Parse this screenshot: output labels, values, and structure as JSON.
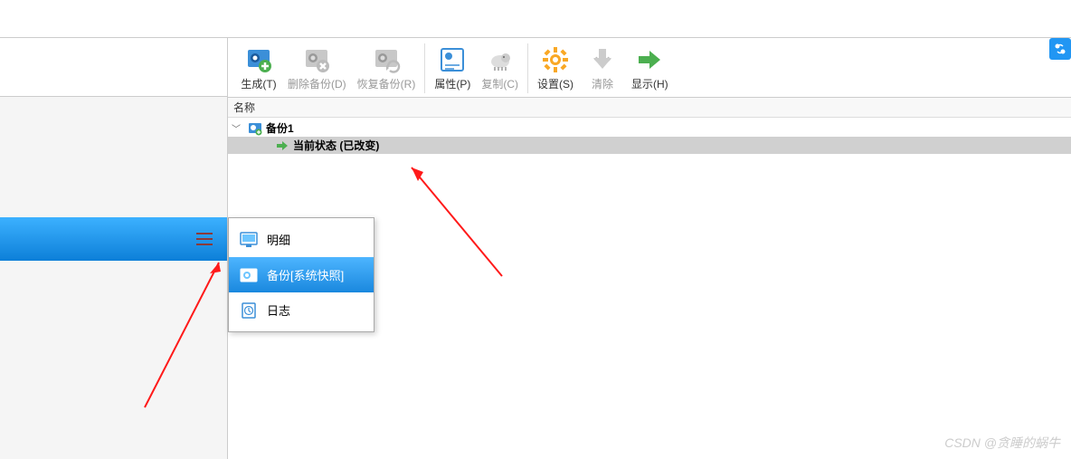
{
  "toolbar": {
    "generate": "生成(T)",
    "delete_backup": "删除备份(D)",
    "restore_backup": "恢复备份(R)",
    "properties": "属性(P)",
    "copy": "复制(C)",
    "settings": "设置(S)",
    "clear": "清除",
    "show": "显示(H)"
  },
  "header": {
    "name": "名称"
  },
  "tree": {
    "root": "备份1",
    "current_state": "当前状态 (已改变)"
  },
  "popup": {
    "detail": "明细",
    "backup": "备份[系统快照]",
    "log": "日志"
  },
  "watermark": "CSDN @贪睡的蜗牛"
}
